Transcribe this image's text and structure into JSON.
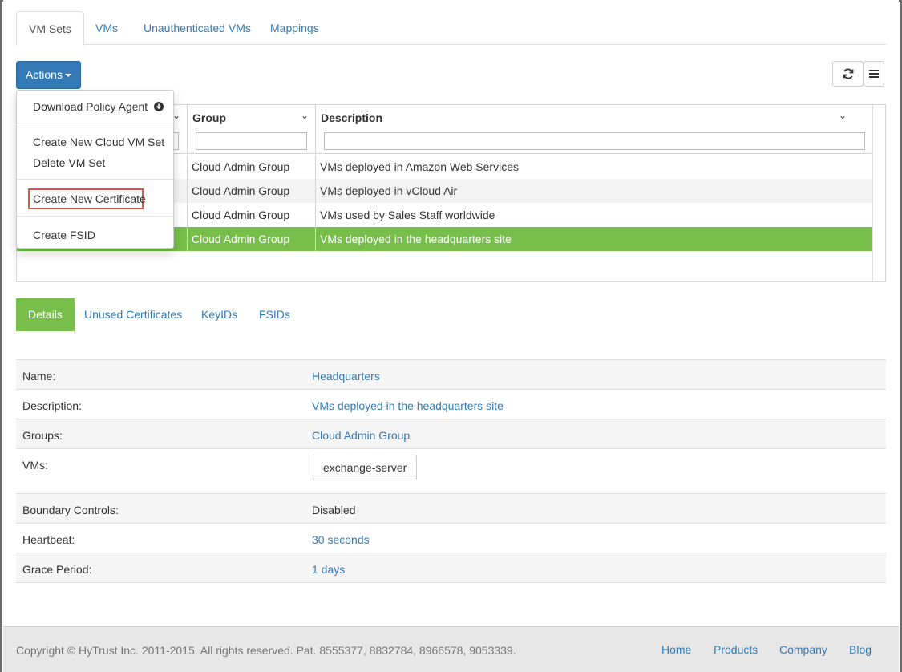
{
  "top_tabs": [
    "VM Sets",
    "VMs",
    "Unauthenticated VMs",
    "Mappings"
  ],
  "toolbar": {
    "actions_label": "Actions",
    "refresh_icon": "refresh-icon",
    "menu_icon": "hamburger-menu-icon"
  },
  "actions_menu": {
    "download_policy_agent": "Download Policy Agent",
    "create_new_cloud_vm_set": "Create New Cloud VM Set",
    "delete_vm_set": "Delete VM Set",
    "create_new_certificate": "Create New Certificate",
    "create_fsid": "Create FSID"
  },
  "grid": {
    "columns": {
      "group": "Group",
      "description": "Description"
    },
    "rows": [
      {
        "group": "Cloud Admin Group",
        "description": "VMs deployed in Amazon Web Services"
      },
      {
        "group": "Cloud Admin Group",
        "description": "VMs deployed in vCloud Air"
      },
      {
        "group": "Cloud Admin Group",
        "description": "VMs used by Sales Staff worldwide"
      },
      {
        "group": "Cloud Admin Group",
        "description": "VMs deployed in the headquarters site"
      }
    ]
  },
  "detail_tabs": [
    "Details",
    "Unused Certificates",
    "KeyIDs",
    "FSIDs"
  ],
  "details": {
    "name_label": "Name:",
    "name_value": "Headquarters",
    "description_label": "Description:",
    "description_value": "VMs deployed in the headquarters site",
    "groups_label": "Groups:",
    "groups_value": "Cloud Admin Group",
    "vms_label": "VMs:",
    "vms_value": "exchange-server",
    "boundary_label": "Boundary Controls:",
    "boundary_value": "Disabled",
    "heartbeat_label": "Heartbeat:",
    "heartbeat_value": "30 seconds",
    "grace_label": "Grace Period:",
    "grace_value": "1 days"
  },
  "footer": {
    "copyright": "Copyright © HyTrust Inc. 2011-2015. All rights reserved. Pat. 8555377, 8832784, 8966578, 9053339.",
    "links": [
      "Home",
      "Products",
      "Company",
      "Blog"
    ]
  },
  "colors": {
    "primary": "#337ab7",
    "selected_row": "#77bf4a",
    "highlight_border": "#d9534f"
  }
}
